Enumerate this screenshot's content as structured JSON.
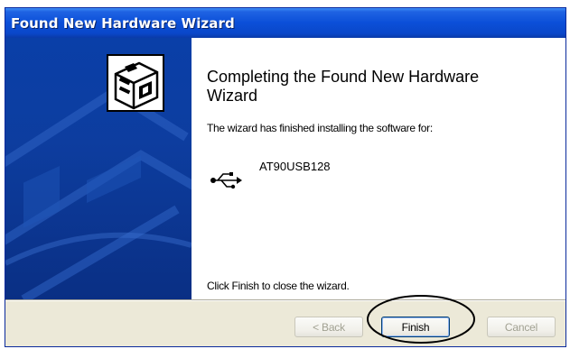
{
  "window": {
    "title": "Found New Hardware Wizard"
  },
  "content": {
    "heading": "Completing the Found New Hardware Wizard",
    "description": "The wizard has finished installing the software for:",
    "device_name": "AT90USB128",
    "device_icon": "usb-icon",
    "closing_text": "Click Finish to close the wizard."
  },
  "buttons": {
    "back": "< Back",
    "finish": "Finish",
    "cancel": "Cancel"
  },
  "colors": {
    "titlebar": "#0b4fd8",
    "sidebar": "#0a3fa8",
    "annotation_ellipse": "#000000"
  }
}
